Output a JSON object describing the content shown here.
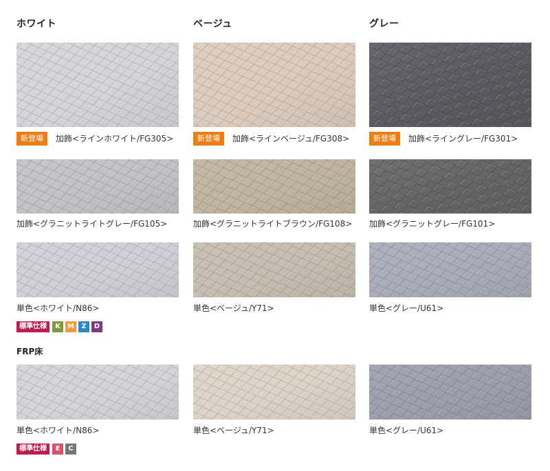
{
  "columns": [
    "ホワイト",
    "ベージュ",
    "グレー"
  ],
  "new_badge": "新登場",
  "rows": [
    [
      "加飾<ラインホワイト/FG305>",
      "加飾<ラインベージュ/FG308>",
      "加飾<ライングレー/FG301>"
    ],
    [
      "加飾<グラニットライトグレー/FG105>",
      "加飾<グラニットライトブラウン/FG108>",
      "加飾<グラニットグレー/FG101>"
    ],
    [
      "単色<ホワイト/N86>",
      "単色<ベージュ/Y71>",
      "単色<グレー/U61>"
    ]
  ],
  "spec1": {
    "standard": "標準仕様",
    "badges": [
      {
        "letter": "K",
        "color": "#7f9a3a"
      },
      {
        "letter": "M",
        "color": "#f29a3a"
      },
      {
        "letter": "Z",
        "color": "#2a86c8"
      },
      {
        "letter": "D",
        "color": "#7b3b82"
      }
    ]
  },
  "frp": {
    "heading": "FRP床",
    "captions": [
      "単色<ホワイト/N86>",
      "単色<ベージュ/Y71>",
      "単色<グレー/U61>"
    ]
  },
  "spec2": {
    "standard": "標準仕様",
    "badges": [
      {
        "letter": "E",
        "color": "#d9506a"
      },
      {
        "letter": "C",
        "color": "#777777"
      }
    ]
  },
  "swatch_colors": {
    "r1": [
      "#d4d4d9",
      "#dccbbd",
      "#5a5a60"
    ],
    "r2": [
      "#c2c2c4",
      "#bfb49f",
      "#646464"
    ],
    "r3": [
      "#cfcfd6",
      "#c7bcb0",
      "#a9abb8"
    ],
    "frp": [
      "#d4d4d6",
      "#dbd3c6",
      "#9c9eac"
    ]
  }
}
